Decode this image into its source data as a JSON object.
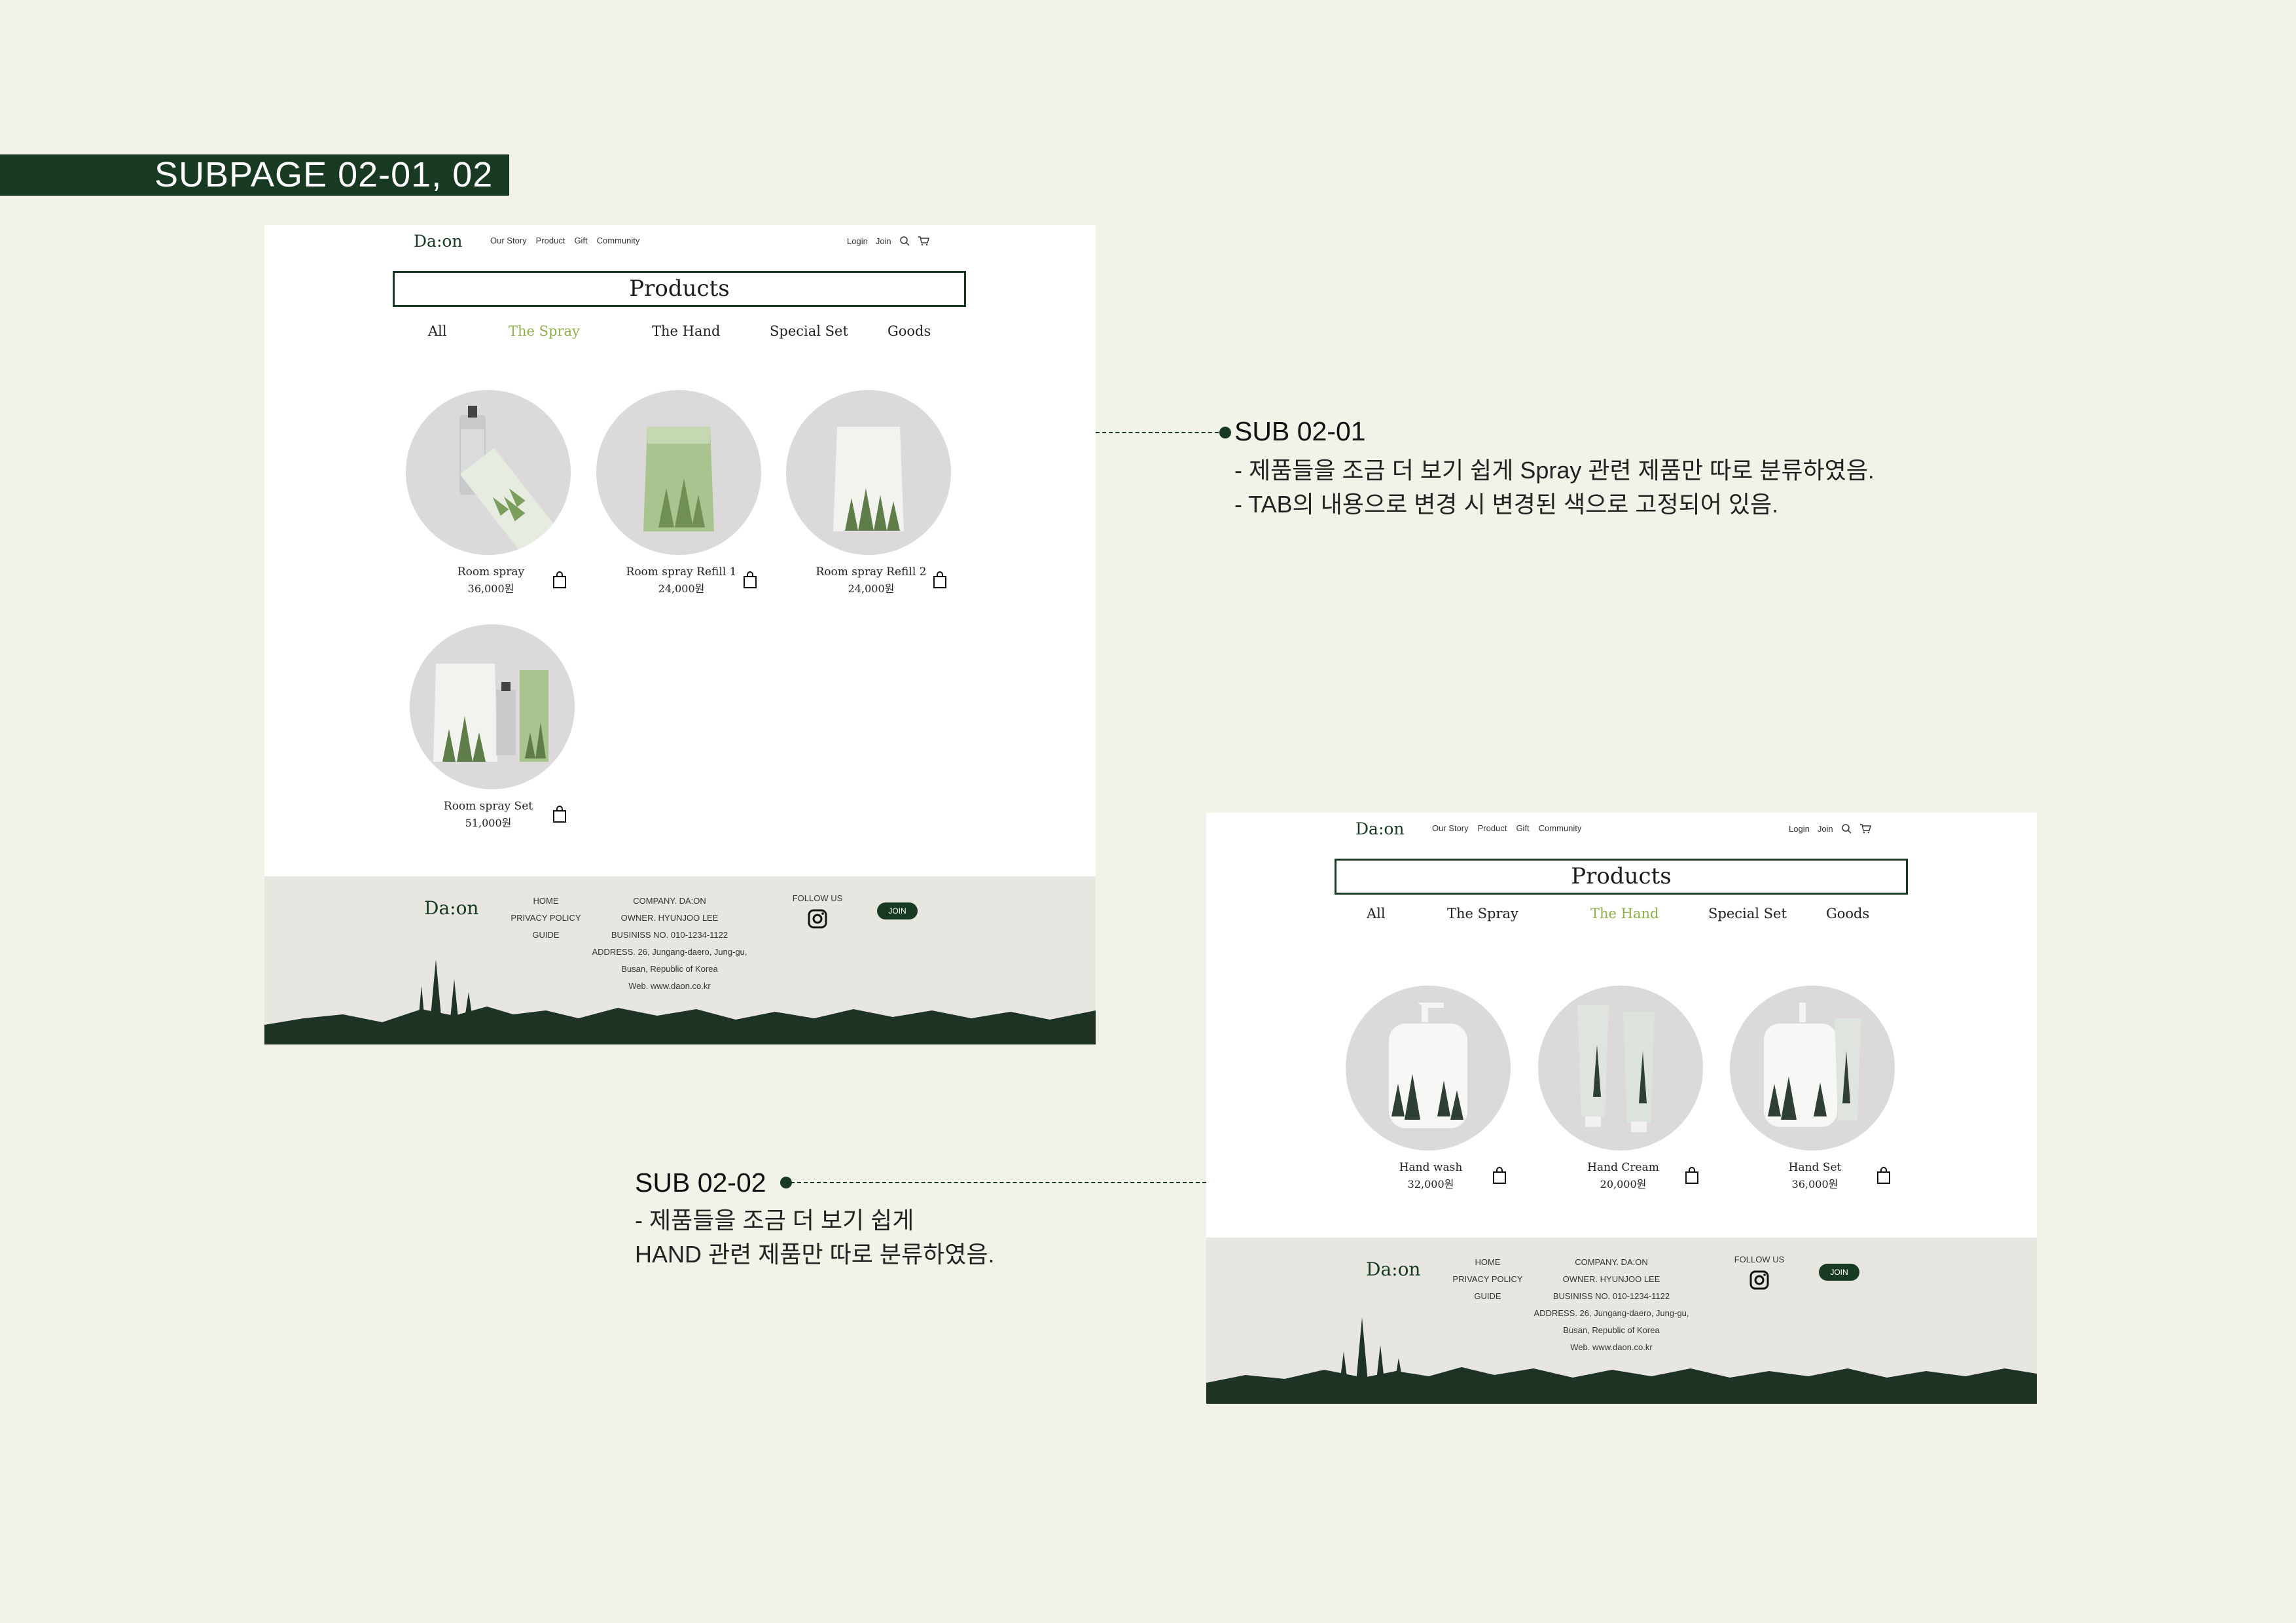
{
  "banner": {
    "title": "SUBPAGE 02-01, 02"
  },
  "site": {
    "logo": "Da:on",
    "nav": [
      "Our Story",
      "Product",
      "Gift",
      "Community"
    ],
    "login": "Login",
    "join": "Join",
    "page_title": "Products",
    "tabs": [
      "All",
      "The Spray",
      "The Hand",
      "Special Set",
      "Goods"
    ]
  },
  "spray_page": {
    "active_tab": "The Spray",
    "products": [
      {
        "name": "Room spray",
        "price": "36,000원"
      },
      {
        "name": "Room spray Refill 1",
        "price": "24,000원"
      },
      {
        "name": "Room spray Refill 2",
        "price": "24,000원"
      },
      {
        "name": "Room spray Set",
        "price": "51,000원"
      }
    ]
  },
  "hand_page": {
    "active_tab": "The Hand",
    "products": [
      {
        "name": "Hand wash",
        "price": "32,000원"
      },
      {
        "name": "Hand Cream",
        "price": "20,000원"
      },
      {
        "name": "Hand Set",
        "price": "36,000원"
      }
    ]
  },
  "footer": {
    "logo": "Da:on",
    "links": [
      "HOME",
      "PRIVACY POLICY",
      "GUIDE"
    ],
    "info": [
      "COMPANY. DA:ON",
      "OWNER. HYUNJOO LEE",
      "BUSINISS NO. 010-1234-1122",
      "ADDRESS. 26, Jungang-daero, Jung-gu,",
      "Busan, Republic of Korea",
      "Web. www.daon.co.kr"
    ],
    "follow": "FOLLOW US",
    "join": "JOIN"
  },
  "annotations": {
    "sub1": {
      "title": "SUB 02-01",
      "lines": [
        "- 제품들을 조금 더 보기 쉽게 Spray 관련 제품만 따로 분류하였음.",
        "- TAB의 내용으로 변경 시 변경된 색으로 고정되어 있음."
      ]
    },
    "sub2": {
      "title": "SUB 02-02",
      "lines": [
        "- 제품들을 조금 더 보기 쉽게",
        "HAND 관련 제품만 따로 분류하였음."
      ]
    }
  },
  "colors": {
    "brand": "#183a22",
    "accent": "#8db04b",
    "page_bg": "#f1f2e8",
    "footer_bg": "#e8e6e1",
    "circle_bg": "#dcd9da"
  },
  "icons": [
    "search-icon",
    "cart-icon",
    "shopping-bag-icon",
    "instagram-icon"
  ]
}
